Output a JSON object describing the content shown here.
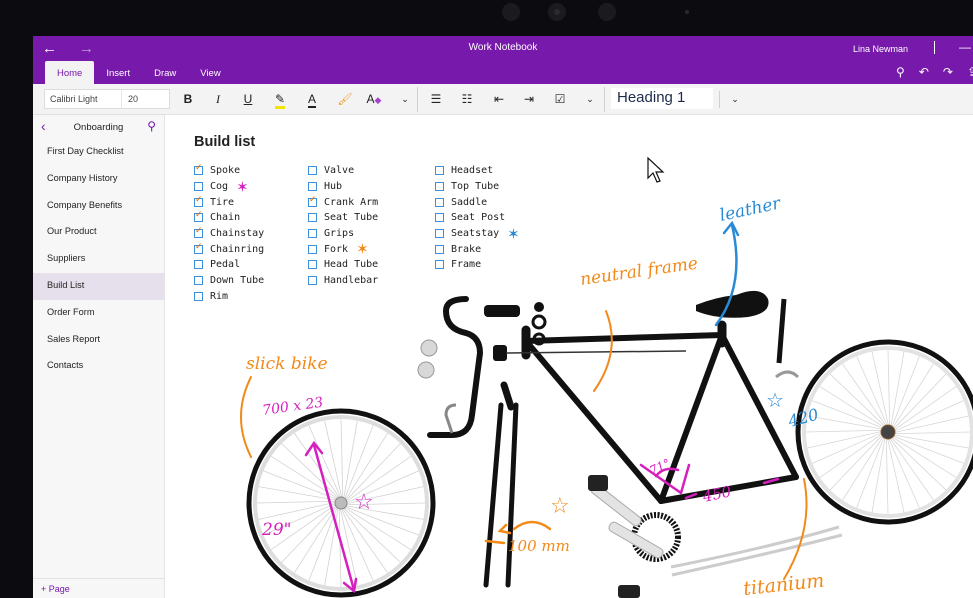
{
  "window": {
    "title": "Work Notebook",
    "user": "Lina Newman"
  },
  "tabs": [
    {
      "label": "Home",
      "active": true
    },
    {
      "label": "Insert",
      "active": false
    },
    {
      "label": "Draw",
      "active": false
    },
    {
      "label": "View",
      "active": false
    }
  ],
  "ribbon": {
    "font_name": "Calibri Light",
    "font_size": "20",
    "style": "Heading 1",
    "buttons": [
      "bold",
      "italic",
      "underline",
      "highlight",
      "font-color",
      "format-painter",
      "clear-formatting",
      "more",
      "bullets",
      "numbering",
      "outdent",
      "indent",
      "todo-tag",
      "more"
    ]
  },
  "section": {
    "title": "Onboarding"
  },
  "pages": [
    {
      "label": "First Day Checklist",
      "active": false
    },
    {
      "label": "Company History",
      "active": false
    },
    {
      "label": "Company Benefits",
      "active": false
    },
    {
      "label": "Our Product",
      "active": false
    },
    {
      "label": "Suppliers",
      "active": false
    },
    {
      "label": "Build List",
      "active": true
    },
    {
      "label": "Order Form",
      "active": false
    },
    {
      "label": "Sales Report",
      "active": false
    },
    {
      "label": "Contacts",
      "active": false
    }
  ],
  "add_page_label": "+ Page",
  "note": {
    "heading": "Build list",
    "columns": [
      [
        {
          "label": "Spoke",
          "checked": true
        },
        {
          "label": "Cog",
          "checked": false,
          "star": "#d61fbf"
        },
        {
          "label": "Tire",
          "checked": true
        },
        {
          "label": "Chain",
          "checked": true
        },
        {
          "label": "Chainstay",
          "checked": true
        },
        {
          "label": "Chainring",
          "checked": true
        },
        {
          "label": "Pedal",
          "checked": false
        },
        {
          "label": "Down Tube",
          "checked": false
        },
        {
          "label": "Rim",
          "checked": false
        }
      ],
      [
        {
          "label": "Valve",
          "checked": false
        },
        {
          "label": "Hub",
          "checked": false
        },
        {
          "label": "Crank Arm",
          "checked": true
        },
        {
          "label": "Seat Tube",
          "checked": false
        },
        {
          "label": "Grips",
          "checked": false
        },
        {
          "label": "Fork",
          "checked": false,
          "star": "#f28a1a"
        },
        {
          "label": "Head Tube",
          "checked": false
        },
        {
          "label": "Handlebar",
          "checked": false
        }
      ],
      [
        {
          "label": "Headset",
          "checked": false
        },
        {
          "label": "Top Tube",
          "checked": false
        },
        {
          "label": "Saddle",
          "checked": false
        },
        {
          "label": "Seat Post",
          "checked": false
        },
        {
          "label": "Seatstay",
          "checked": false,
          "star": "#2a8bd4"
        },
        {
          "label": "Brake",
          "checked": false
        },
        {
          "label": "Frame",
          "checked": false
        }
      ]
    ],
    "annotations": {
      "slick_bike": "slick bike",
      "tire_size": "700 x 23",
      "wheel_size": "29\"",
      "neutral_frame": "neutral frame",
      "leather": "leather",
      "angle": "71°",
      "tube_length": "450",
      "seatstay_length": "420",
      "crank_length": "100 mm",
      "titanium": "titanium"
    }
  },
  "colors": {
    "accent": "#7719aa",
    "ink_orange": "#f28a1a",
    "ink_magenta": "#d61fbf",
    "ink_blue": "#2a8bd4",
    "checkbox": "#3f8fd8"
  }
}
